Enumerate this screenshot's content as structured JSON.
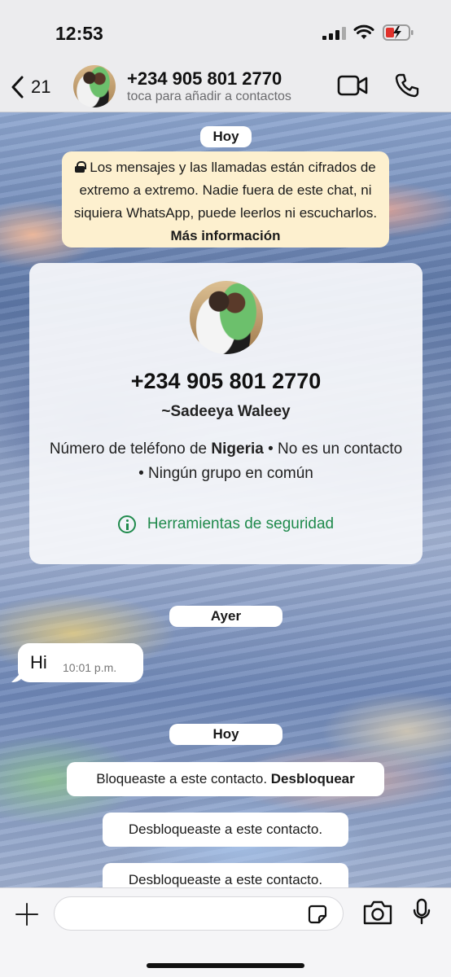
{
  "status_bar": {
    "time": "12:53"
  },
  "header": {
    "back_count": "21",
    "contact_phone": "+234 905 801 2770",
    "contact_subtitle": "toca para añadir a contactos"
  },
  "chat": {
    "date_today_1": "Hoy",
    "encryption": {
      "text": "Los mensajes y las llamadas están cifrados de extremo a extremo. Nadie fuera de este chat, ni siquiera WhatsApp, puede leerlos ni escucharlos.",
      "link": "Más información"
    },
    "contact_card": {
      "phone": "+234 905 801 2770",
      "alias": "~Sadeeya Waleey",
      "details_prefix": "Número de teléfono de",
      "country": "Nigeria",
      "details_suffix": "• No es un contacto • Ningún grupo en común",
      "safety_tools": "Herramientas de seguridad"
    },
    "date_yesterday": "Ayer",
    "message": {
      "text": "Hi",
      "time": "10:01 p.m."
    },
    "date_today_2": "Hoy",
    "blocked": {
      "text": "Bloqueaste a este contacto.",
      "action": "Desbloquear"
    },
    "unblocked_1": "Desbloqueaste a este contacto.",
    "unblocked_2": "Desbloqueaste a este contacto."
  },
  "composer": {
    "placeholder": ""
  },
  "colors": {
    "accent_green": "#1f8a4c",
    "notice_bg": "#fdf0cf",
    "battery_red": "#e0312b"
  }
}
